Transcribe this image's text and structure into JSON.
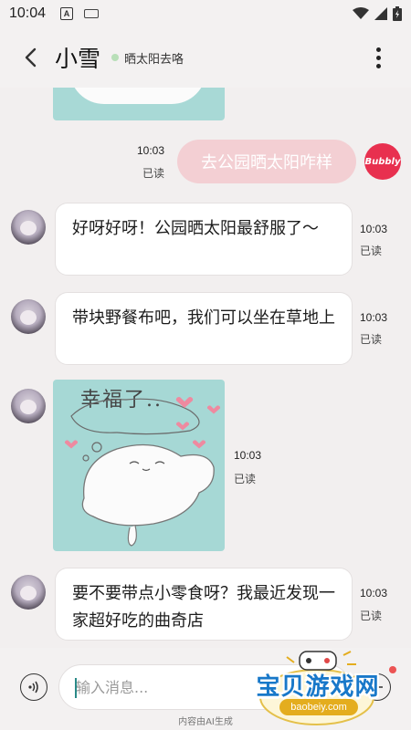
{
  "status_bar": {
    "time": "10:04",
    "a_icon": "A"
  },
  "header": {
    "name": "小雪",
    "status": "晒太阳去咯"
  },
  "messages": {
    "out1": {
      "text": "去公园晒太阳咋样",
      "time": "10:03",
      "read": "已读",
      "avatar_label": "Bubbly"
    },
    "in1": {
      "text": "好呀好呀！公园晒太阳最舒服了～",
      "time": "10:03",
      "read": "已读"
    },
    "in2": {
      "text": "带块野餐布吧，我们可以坐在草地上",
      "time": "10:03",
      "read": "已读"
    },
    "sticker": {
      "caption": "幸福了..",
      "time": "10:03",
      "read": "已读"
    },
    "in3": {
      "text": "要不要带点小零食呀？我最近发现一家超好吃的曲奇店",
      "time": "10:03",
      "read": "已读"
    }
  },
  "input": {
    "placeholder": "输入消息..."
  },
  "disclaimer": "内容由AI生成",
  "watermark": {
    "title": "宝贝游戏网",
    "url": "baobeiy.com"
  },
  "colors": {
    "outgoing_bubble": "#f3cfd3",
    "online_dot": "#b8dfb8",
    "sticker_bg": "#a6d8d5",
    "badge": "#ec5454"
  },
  "icons": [
    "back-arrow-icon",
    "more-vertical-icon",
    "voice-icon",
    "plus-icon",
    "wifi-icon",
    "signal-icon",
    "battery-icon"
  ]
}
